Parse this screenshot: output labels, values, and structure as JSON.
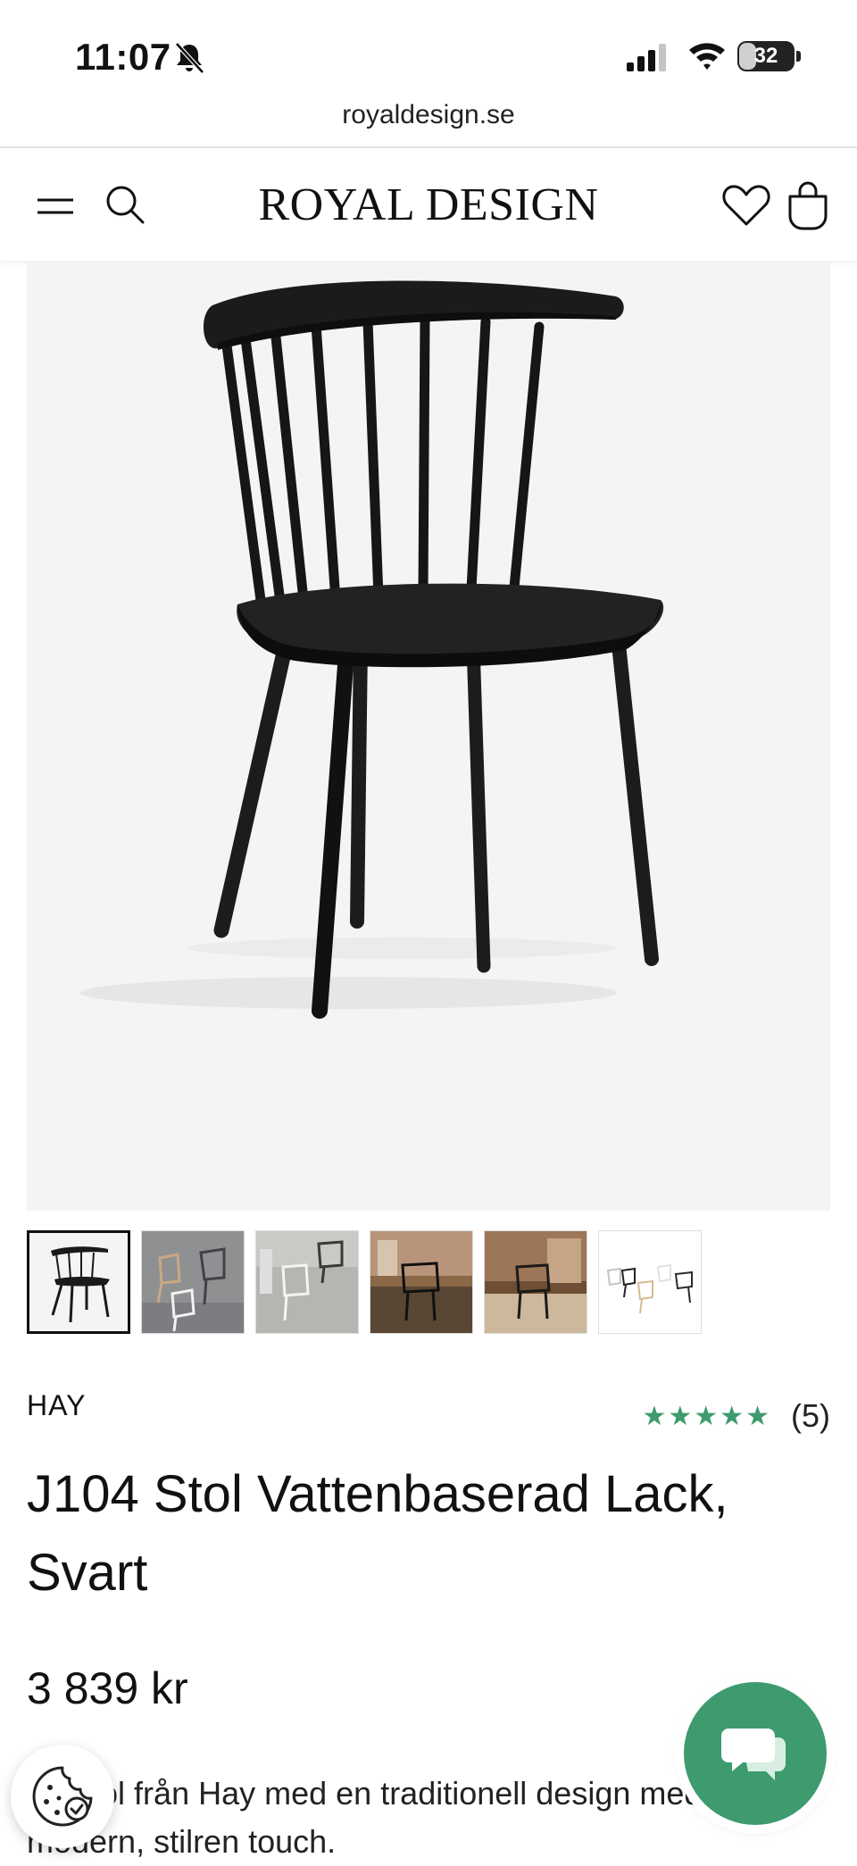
{
  "status_bar": {
    "time": "11:07",
    "battery": "32",
    "battery_level": 0.32
  },
  "browser": {
    "url": "royaldesign.se"
  },
  "header": {
    "logo": "ROYAL DESIGN"
  },
  "product": {
    "brand": "HAY",
    "rating": {
      "stars": "★★★★★",
      "count": "(5)",
      "value": 5
    },
    "title": "J104 Stol Vattenbaserad Lack, Svart",
    "price": "3 839 kr",
    "description": "En stol från Hay med en traditionell design med en modern, stilren touch."
  },
  "thumbnails": [
    {
      "name": "thumb-black-chair",
      "active": true
    },
    {
      "name": "thumb-chairs-group"
    },
    {
      "name": "thumb-white-chairs"
    },
    {
      "name": "thumb-interior-dark"
    },
    {
      "name": "thumb-interior-wood"
    },
    {
      "name": "thumb-colour-range"
    }
  ],
  "colors": {
    "accent": "#3d9b6e",
    "image_bg": "#f4f4f4",
    "text": "#111111"
  },
  "icons": [
    "bell-off-icon",
    "signal-icon",
    "wifi-icon",
    "battery-icon",
    "menu-icon",
    "search-icon",
    "heart-icon",
    "bag-icon",
    "cookie-icon",
    "chat-icon"
  ]
}
